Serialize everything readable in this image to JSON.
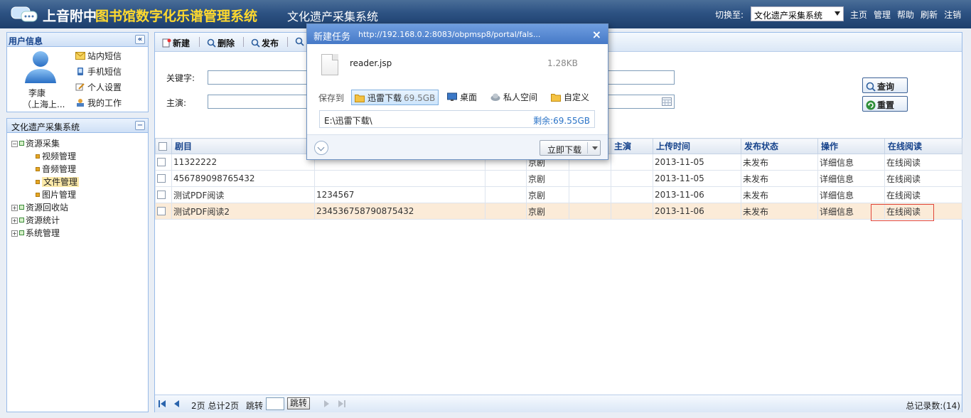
{
  "header": {
    "title_part1": "上音附中",
    "title_part2": "图书馆数字化乐谱管理系统",
    "subsystem": "文化遗产采集系统",
    "switch_label": "切换至:",
    "switch_value": "文化遗产采集系统",
    "links": [
      "主页",
      "管理",
      "帮助",
      "刷新",
      "注销"
    ]
  },
  "user_panel": {
    "title": "用户信息",
    "name": "李康",
    "org": "（上海上...",
    "links": [
      "站内短信",
      "手机短信",
      "个人设置",
      "我的工作"
    ]
  },
  "nav_panel": {
    "title": "文化遗产采集系统",
    "tree": [
      {
        "label": "资源采集",
        "expanded": true,
        "children": [
          "视频管理",
          "音频管理",
          "文件管理",
          "图片管理"
        ],
        "selected": "文件管理"
      },
      {
        "label": "资源回收站"
      },
      {
        "label": "资源统计"
      },
      {
        "label": "系统管理"
      }
    ]
  },
  "toolbar": {
    "new": "新建",
    "delete": "删除",
    "publish": "发布"
  },
  "search": {
    "keyword_label": "关键字:",
    "actor_label": "主演:",
    "query_btn": "查询",
    "reset_btn": "重置"
  },
  "grid": {
    "columns": [
      "剧目",
      "",
      "",
      "",
      "主演",
      "上传时间",
      "发布状态",
      "操作",
      "在线阅读"
    ],
    "rows": [
      [
        "11322222",
        "",
        "",
        "京剧",
        "",
        "",
        "2013-11-05",
        "未发布",
        "详细信息",
        "在线阅读"
      ],
      [
        "456789098765432",
        "",
        "",
        "京剧",
        "",
        "",
        "2013-11-05",
        "未发布",
        "详细信息",
        "在线阅读"
      ],
      [
        "测试PDF阅读",
        "1234567",
        "",
        "京剧",
        "",
        "",
        "2013-11-06",
        "未发布",
        "详细信息",
        "在线阅读"
      ],
      [
        "测试PDF阅读2",
        "234536758790875432",
        "",
        "京剧",
        "",
        "",
        "2013-11-06",
        "未发布",
        "详细信息",
        "在线阅读"
      ]
    ]
  },
  "pager": {
    "info": "2页 总计2页",
    "jump_label": "跳转",
    "jump_btn": "跳转",
    "total": "总记录数:(14)"
  },
  "download_dialog": {
    "title": "新建任务",
    "url": "http://192.168.0.2:8083/obpmsp8/portal/fals...",
    "filename": "reader.jsp",
    "filesize": "1.28KB",
    "save_to_label": "保存到",
    "options": [
      {
        "label": "迅雷下载",
        "free": "69.5GB"
      },
      {
        "label": "桌面",
        "free": ""
      },
      {
        "label": "私人空间",
        "free": ""
      },
      {
        "label": "自定义",
        "free": ""
      }
    ],
    "path": "E:\\迅雷下载\\",
    "remaining": "剩余:69.55GB",
    "download_btn": "立即下载"
  },
  "colors": {
    "header": "#2d5283",
    "title_yellow": "#ffd92e",
    "grid_header_text": "#15428b",
    "highlight_row": "#fbebd8"
  }
}
